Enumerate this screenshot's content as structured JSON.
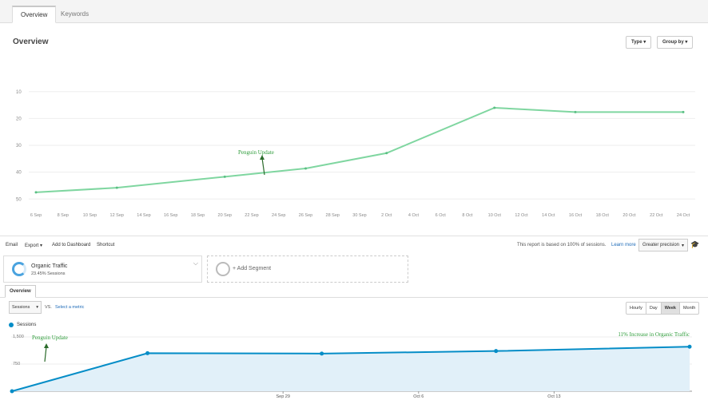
{
  "tabs": [
    {
      "label": "Overview",
      "active": true
    },
    {
      "label": "Keywords",
      "active": false
    }
  ],
  "page_title": "Overview",
  "header_buttons": {
    "type": "Type",
    "group_by": "Group by"
  },
  "ranking_chart": {
    "type": "line",
    "y_ticks": [
      "10",
      "20",
      "30",
      "40",
      "50"
    ],
    "ylim_reversed": [
      5,
      52
    ],
    "x_ticks": [
      "6 Sep",
      "8 Sep",
      "10 Sep",
      "12 Sep",
      "14 Sep",
      "16 Sep",
      "18 Sep",
      "20 Sep",
      "22 Sep",
      "24 Sep",
      "26 Sep",
      "28 Sep",
      "30 Sep",
      "2 Oct",
      "4 Oct",
      "6 Oct",
      "8 Oct",
      "10 Oct",
      "12 Oct",
      "14 Oct",
      "16 Oct",
      "18 Oct",
      "20 Oct",
      "22 Oct",
      "24 Oct"
    ],
    "points": [
      {
        "x": "6 Sep",
        "y": 47.5
      },
      {
        "x": "12 Sep",
        "y": 45.8
      },
      {
        "x": "20 Sep",
        "y": 41.7
      },
      {
        "x": "26 Sep",
        "y": 38.6
      },
      {
        "x": "2 Oct",
        "y": 32.9
      },
      {
        "x": "10 Oct",
        "y": 16.0
      },
      {
        "x": "16 Oct",
        "y": 17.6
      },
      {
        "x": "24 Oct",
        "y": 17.6
      }
    ],
    "line_color": "#7fd6a0",
    "annotation": "Penguin Update"
  },
  "toolbar": {
    "email": "Email",
    "export": "Export",
    "add_dashboard": "Add to Dashboard",
    "shortcut": "Shortcut",
    "sampling_text": "This report is based on 100% of sessions.",
    "learn_more": "Learn more",
    "precision": "Greater precision"
  },
  "segment": {
    "name": "Organic Traffic",
    "sub": "23.45% Sessions"
  },
  "add_segment": "+ Add Segment",
  "subtab": "Overview",
  "metric_select": "Sessions",
  "vs": "VS.",
  "select_metric": "Select a metric",
  "periods": [
    "Hourly",
    "Day",
    "Week",
    "Month"
  ],
  "active_period": "Week",
  "legend": "Sessions",
  "sessions_chart": {
    "type": "area",
    "y_ticks": [
      "1,500",
      "750"
    ],
    "ylim": [
      0,
      1500
    ],
    "x_ticks": [
      "Sep 29",
      "Oct 6",
      "Oct 13"
    ],
    "points": [
      {
        "x": "Sep 15",
        "y": 0
      },
      {
        "x": "Sep 22",
        "y": 1050
      },
      {
        "x": "Oct 1",
        "y": 1040
      },
      {
        "x": "Oct 10",
        "y": 1110
      },
      {
        "x": "Oct 20",
        "y": 1230
      }
    ],
    "line_color": "#058dc7",
    "fill_color": "#e1f0f9",
    "annotation_left": "Penguin Update",
    "annotation_right": "11% Increase in Organic Traffic",
    "annotation_color": "#2e9c3a"
  }
}
